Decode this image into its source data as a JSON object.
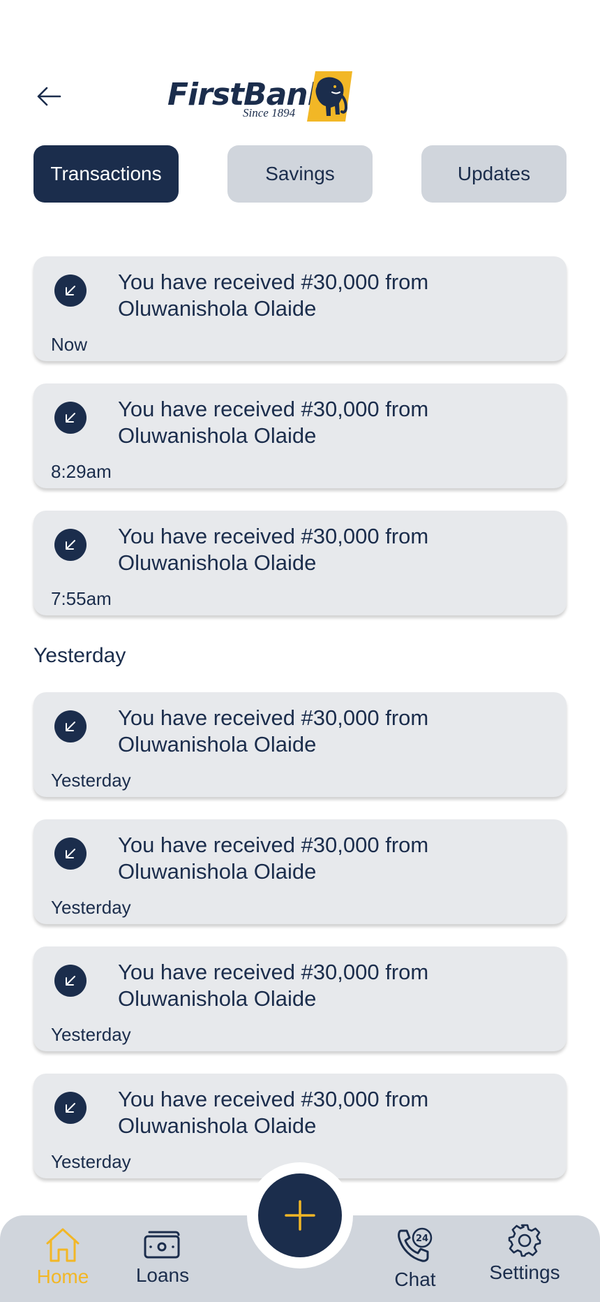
{
  "header": {
    "back_icon": "arrow-left-icon",
    "logo": {
      "name": "FirstBank",
      "tagline": "Since 1894",
      "brand_color": "#1b2d4c",
      "accent_color": "#f2b726"
    }
  },
  "tabs": [
    {
      "label": "Transactions",
      "active": true
    },
    {
      "label": "Savings",
      "active": false
    },
    {
      "label": "Updates",
      "active": false
    }
  ],
  "today_items": [
    {
      "icon": "arrow-down-left-icon",
      "message": "You have received #30,000 from Oluwanishola Olaide",
      "time": "Now"
    },
    {
      "icon": "arrow-down-left-icon",
      "message": "You have received #30,000 from Oluwanishola Olaide",
      "time": "8:29am"
    },
    {
      "icon": "arrow-down-left-icon",
      "message": "You have received #30,000 from Oluwanishola Olaide",
      "time": "7:55am"
    }
  ],
  "yesterday_section": {
    "heading": "Yesterday",
    "items": [
      {
        "icon": "arrow-down-left-icon",
        "message": "You have received #30,000 from Oluwanishola Olaide",
        "time": "Yesterday"
      },
      {
        "icon": "arrow-down-left-icon",
        "message": "You have received #30,000 from Oluwanishola Olaide",
        "time": "Yesterday"
      },
      {
        "icon": "arrow-down-left-icon",
        "message": "You have received #30,000 from Oluwanishola Olaide",
        "time": "Yesterday"
      },
      {
        "icon": "arrow-down-left-icon",
        "message": "You have received #30,000 from Oluwanishola Olaide",
        "time": "Yesterday"
      }
    ]
  },
  "fab": {
    "icon": "plus-icon"
  },
  "bottom_nav": {
    "home": {
      "label": "Home",
      "icon": "home-icon",
      "active": true
    },
    "loans": {
      "label": "Loans",
      "icon": "cash-icon",
      "active": false
    },
    "chat": {
      "label": "Chat",
      "icon": "phone-24-icon",
      "active": false
    },
    "settings": {
      "label": "Settings",
      "icon": "gear-icon",
      "active": false
    }
  },
  "colors": {
    "primary": "#1b2d4c",
    "accent": "#f2b726",
    "card_bg": "#e7e9ec",
    "tab_inactive": "#d0d5dc"
  }
}
